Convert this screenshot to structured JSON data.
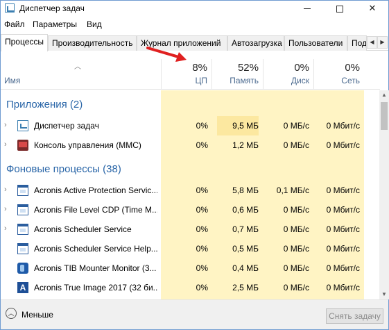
{
  "window": {
    "title": "Диспетчер задач"
  },
  "menu": [
    "Файл",
    "Параметры",
    "Вид"
  ],
  "tabs": [
    "Процессы",
    "Производительность",
    "Журнал приложений",
    "Автозагрузка",
    "Пользователи",
    "Под"
  ],
  "header": {
    "name_label": "Имя",
    "cpu": {
      "value": "8%",
      "label": "ЦП"
    },
    "mem": {
      "value": "52%",
      "label": "Память"
    },
    "disk": {
      "value": "0%",
      "label": "Диск"
    },
    "net": {
      "value": "0%",
      "label": "Сеть"
    }
  },
  "groups": {
    "apps": "Приложения (2)",
    "background": "Фоновые процессы (38)"
  },
  "apps": [
    {
      "name": "Диспетчер задач",
      "cpu": "0%",
      "mem": "9,5 МБ",
      "disk": "0 МБ/с",
      "net": "0 Мбит/с",
      "icon": "task-manager-icon"
    },
    {
      "name": "Консоль управления (MMC)",
      "cpu": "0%",
      "mem": "1,2 МБ",
      "disk": "0 МБ/с",
      "net": "0 Мбит/с",
      "icon": "mmc-icon"
    }
  ],
  "background": [
    {
      "name": "Acronis Active Protection Servic...",
      "cpu": "0%",
      "mem": "5,8 МБ",
      "disk": "0,1 МБ/с",
      "net": "0 Мбит/с",
      "icon": "service-window-icon"
    },
    {
      "name": "Acronis File Level CDP (Time M...",
      "cpu": "0%",
      "mem": "0,6 МБ",
      "disk": "0 МБ/с",
      "net": "0 Мбит/с",
      "icon": "service-window-icon"
    },
    {
      "name": "Acronis Scheduler Service",
      "cpu": "0%",
      "mem": "0,7 МБ",
      "disk": "0 МБ/с",
      "net": "0 Мбит/с",
      "icon": "service-window-icon"
    },
    {
      "name": "Acronis Scheduler Service Help...",
      "cpu": "0%",
      "mem": "0,5 МБ",
      "disk": "0 МБ/с",
      "net": "0 Мбит/с",
      "icon": "service-window-icon"
    },
    {
      "name": "Acronis TIB Mounter Monitor (3...",
      "cpu": "0%",
      "mem": "0,4 МБ",
      "disk": "0 МБ/с",
      "net": "0 Мбит/с",
      "icon": "tib-mounter-icon"
    },
    {
      "name": "Acronis True Image 2017 (32 би...",
      "cpu": "0%",
      "mem": "2,5 МБ",
      "disk": "0 МБ/с",
      "net": "0 Мбит/с",
      "icon": "true-image-icon"
    }
  ],
  "footer": {
    "less": "Меньше",
    "end_task": "Снять задачу"
  },
  "colors": {
    "heat_light": "#fff4c4",
    "heat_mid": "#fce8a0",
    "group_title": "#2a66a8",
    "annotation": "#e02020"
  }
}
